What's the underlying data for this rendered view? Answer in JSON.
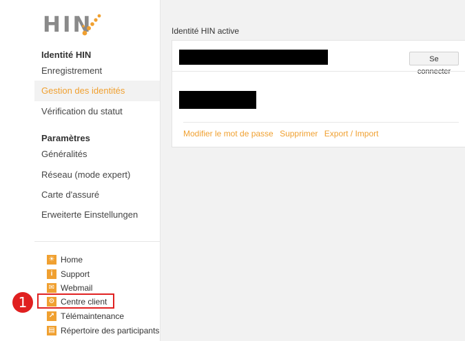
{
  "brand": {
    "logo_text": "HIN"
  },
  "sidebar": {
    "section1": {
      "heading": "Identité HIN",
      "items": [
        {
          "label": "Enregistrement"
        },
        {
          "label": "Gestion des identités",
          "active": true
        },
        {
          "label": "Vérification du statut"
        }
      ]
    },
    "section2": {
      "heading": "Paramètres",
      "items": [
        {
          "label": "Généralités"
        },
        {
          "label": "Réseau (mode expert)"
        },
        {
          "label": "Carte d'assuré"
        },
        {
          "label": "Erweiterte Einstellungen"
        }
      ]
    },
    "links": [
      {
        "label": "Home",
        "icon": "sun-icon"
      },
      {
        "label": "Support",
        "icon": "info-icon"
      },
      {
        "label": "Webmail",
        "icon": "mail-icon"
      },
      {
        "label": "Centre client",
        "icon": "gear-icon"
      },
      {
        "label": "Télémaintenance",
        "icon": "wrench-icon"
      },
      {
        "label": "Répertoire des participants",
        "icon": "directory-icon"
      }
    ]
  },
  "annotation": {
    "step_number": "1",
    "highlight_color": "#e02020"
  },
  "main": {
    "title": "Identité HIN active",
    "connect_button": "Se connecter",
    "actions": [
      "Modifier le mot de passe",
      "Supprimer",
      "Export / Import"
    ]
  },
  "colors": {
    "accent": "#f0a030",
    "main_bg": "#f2f2f2"
  }
}
